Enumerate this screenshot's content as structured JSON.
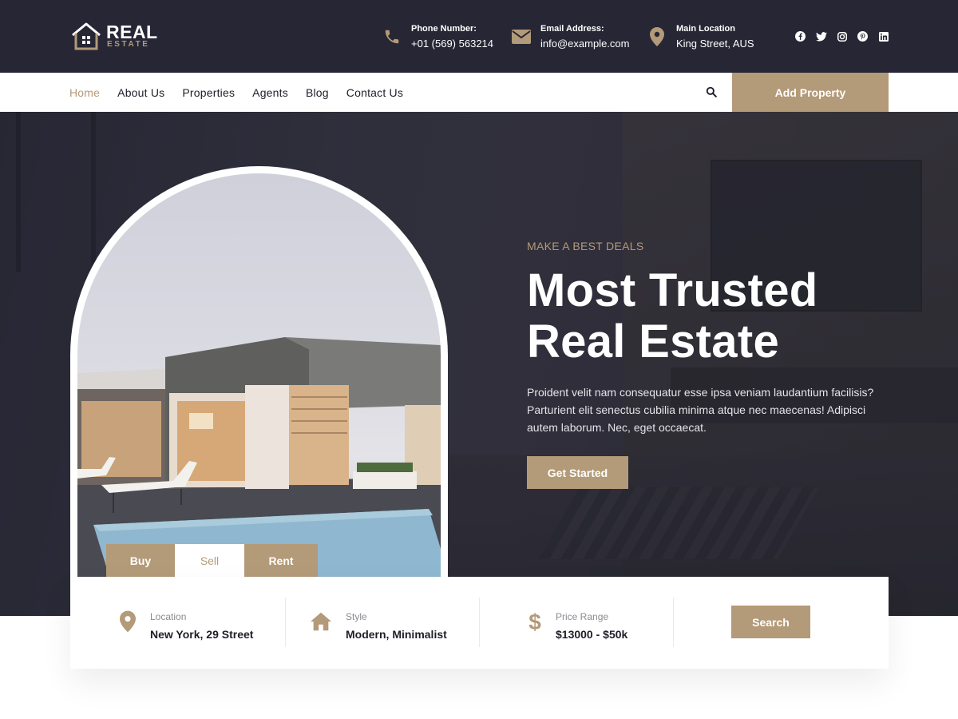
{
  "brand": {
    "name": "REAL",
    "sub": "ESTATE"
  },
  "contacts": [
    {
      "icon": "phone-icon",
      "label": "Phone Number:",
      "value": "+01 (569) 563214"
    },
    {
      "icon": "envelope-icon",
      "label": "Email Address:",
      "value": "info@example.com"
    },
    {
      "icon": "map-pin-icon",
      "label": "Main Location",
      "value": "King Street, AUS"
    }
  ],
  "socials": [
    "facebook-icon",
    "twitter-icon",
    "instagram-icon",
    "pinterest-icon",
    "linkedin-icon"
  ],
  "nav": {
    "items": [
      "Home",
      "About Us",
      "Properties",
      "Agents",
      "Blog",
      "Contact Us"
    ],
    "active": "Home",
    "cta": "Add Property"
  },
  "hero": {
    "eyebrow": "MAKE A BEST DEALS",
    "title_line1": "Most Trusted",
    "title_line2": "Real Estate",
    "description": "Proident velit nam consequatur esse ipsa veniam laudantium facilisis? Parturient elit senectus cubilia minima atque nec maecenas! Adipisci autem laborum. Nec, eget occaecat.",
    "cta": "Get Started",
    "tabs": [
      "Buy",
      "Sell",
      "Rent"
    ],
    "selected_tab": "Sell"
  },
  "search": {
    "location": {
      "label": "Location",
      "value": "New York, 29 Street"
    },
    "style": {
      "label": "Style",
      "value": "Modern, Minimalist"
    },
    "price": {
      "label": "Price Range",
      "value": "$13000 - $50k"
    },
    "button": "Search"
  },
  "colors": {
    "dark": "#262635",
    "accent": "#b39a78",
    "white": "#ffffff"
  }
}
